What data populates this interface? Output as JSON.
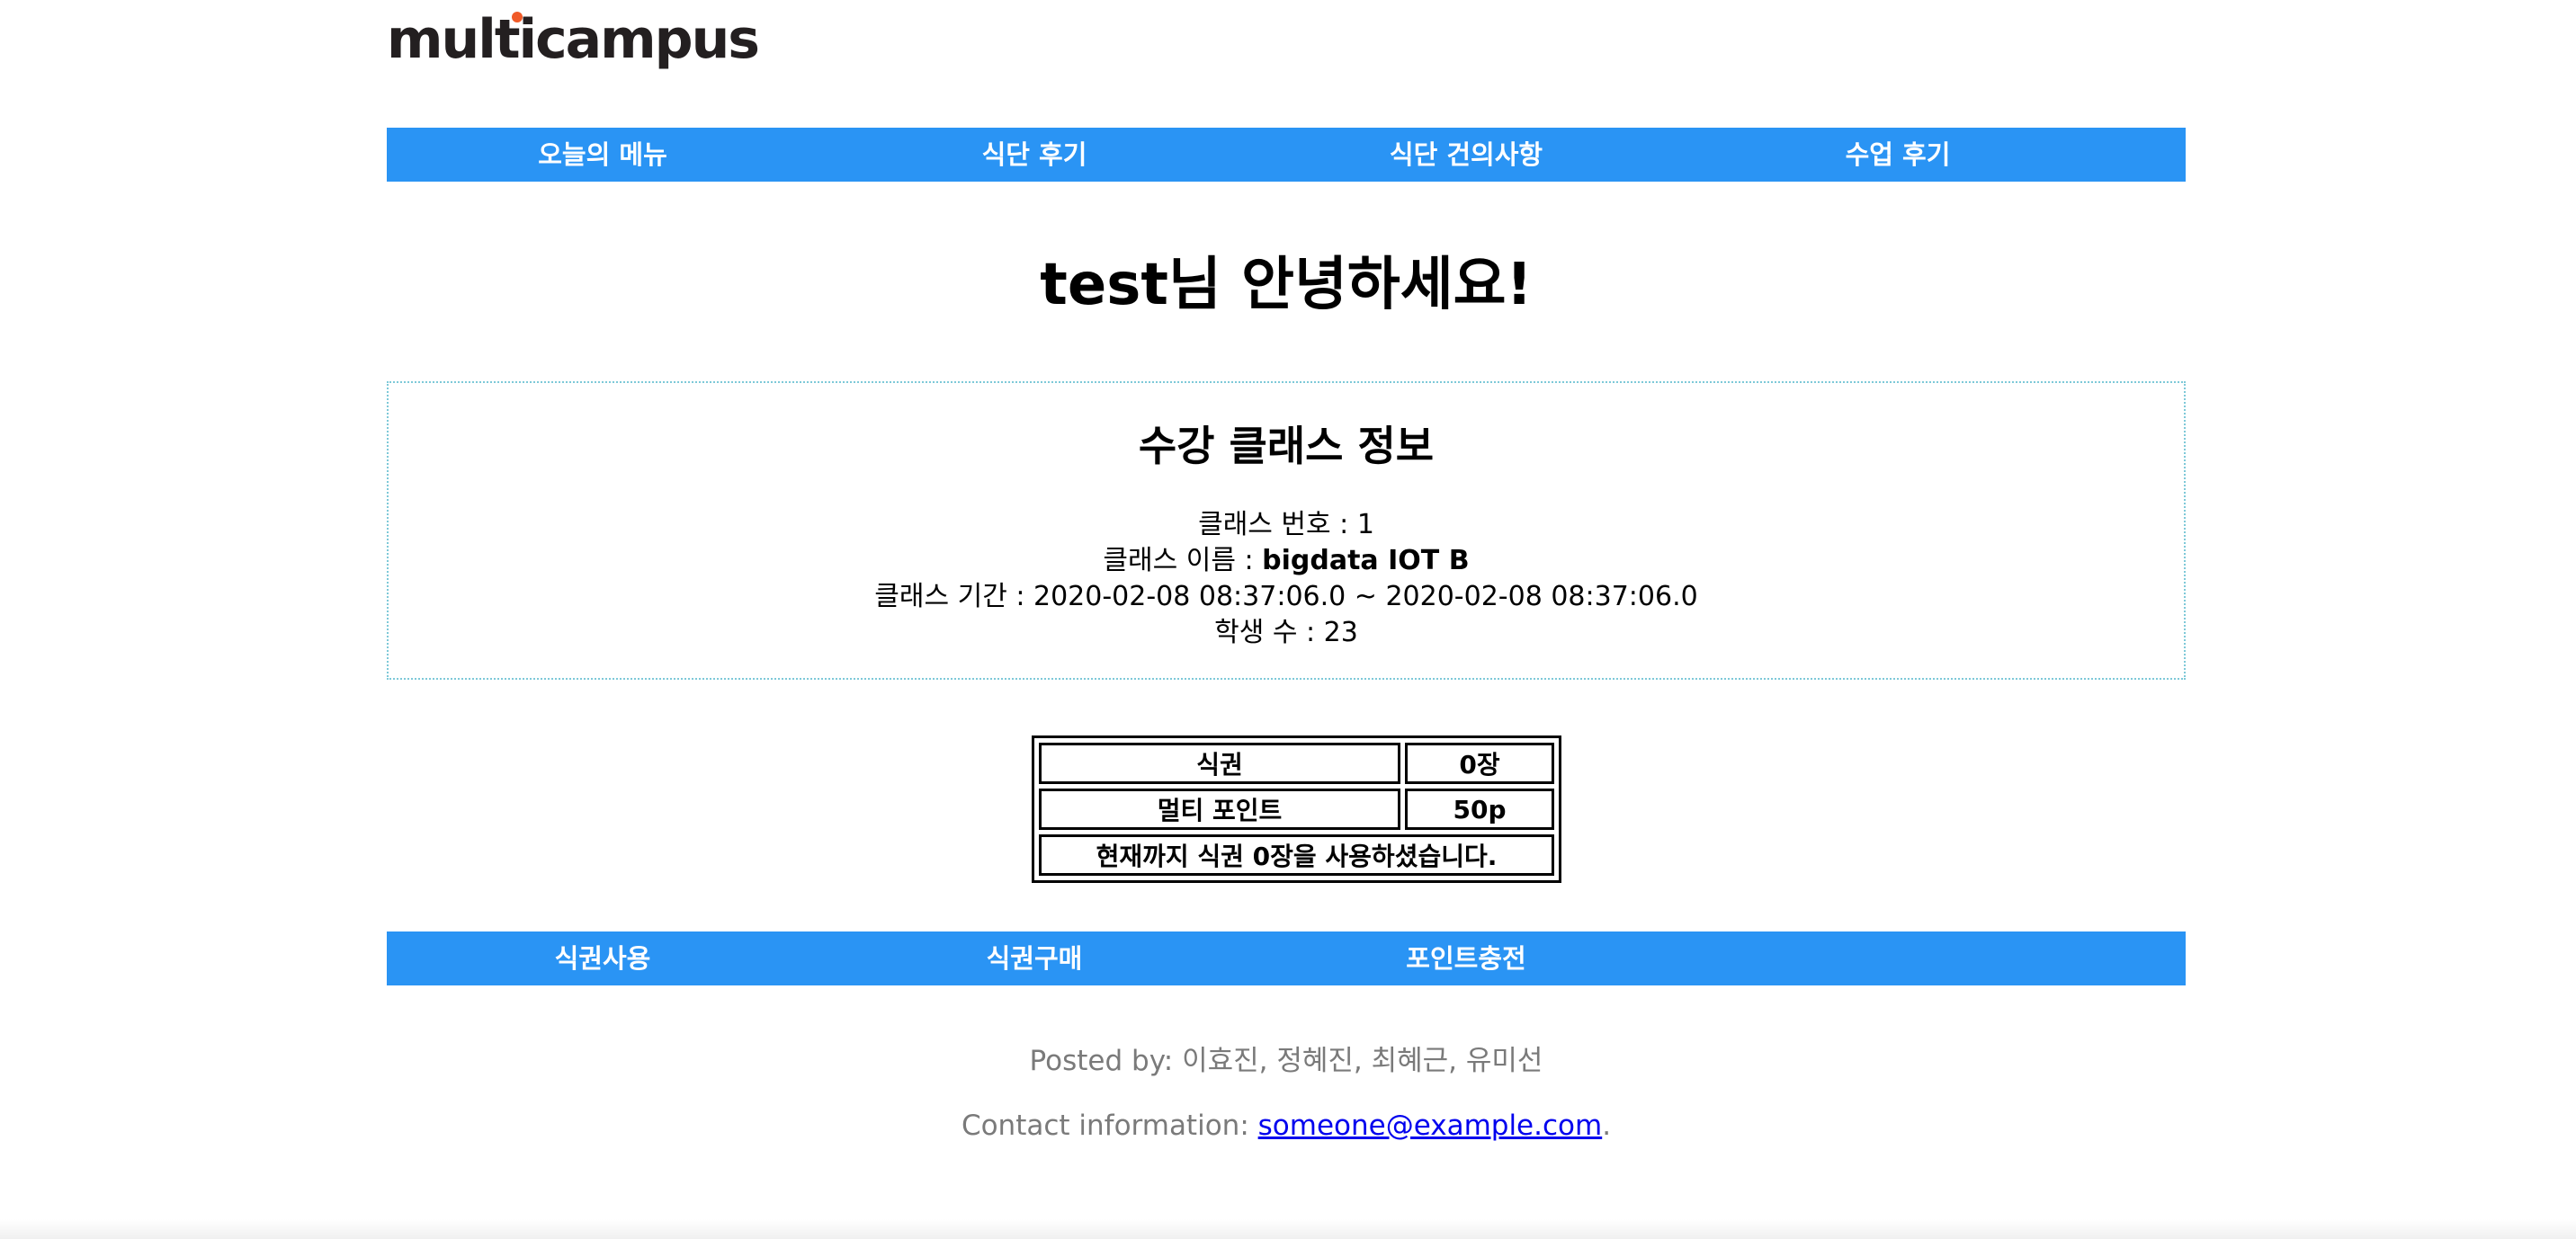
{
  "logo": {
    "text_before": "mul",
    "text_accent": "ti",
    "text_after": "campus",
    "accent_color": "#f05a28"
  },
  "top_nav": {
    "items": [
      {
        "label": "오늘의 메뉴"
      },
      {
        "label": "식단 후기"
      },
      {
        "label": "식단 건의사항"
      },
      {
        "label": "수업 후기"
      }
    ],
    "background_color": "#2a94f4"
  },
  "greeting": "test님 안녕하세요!",
  "class_info": {
    "title": "수강 클래스 정보",
    "number_label": "클래스 번호 : ",
    "number_value": "1",
    "name_label": "클래스 이름 : ",
    "name_value": "bigdata IOT B",
    "period_label": "클래스 기간 : ",
    "period_value": "2020-02-08 08:37:06.0 ~ 2020-02-08 08:37:06.0",
    "students_label": "학생 수 : ",
    "students_value": "23"
  },
  "ticket_table": {
    "rows": [
      {
        "label": "식권",
        "value": "0장"
      },
      {
        "label": "멀티 포인트",
        "value": "50p"
      }
    ],
    "summary": "현재까지 식권 0장을 사용하셨습니다."
  },
  "bottom_nav": {
    "items": [
      {
        "label": "식권사용"
      },
      {
        "label": "식권구매"
      },
      {
        "label": "포인트충전"
      }
    ]
  },
  "footer": {
    "posted_by": "Posted by: 이효진, 정혜진, 최혜근, 유미선",
    "contact_label": "Contact information: ",
    "contact_email": "someone@example.com",
    "contact_suffix": "."
  }
}
